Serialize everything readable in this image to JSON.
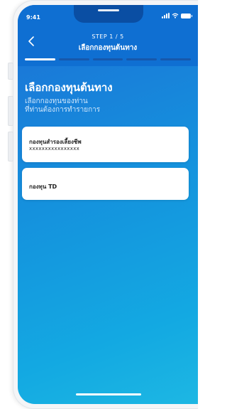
{
  "status_bar": {
    "time": "9:41",
    "icons": [
      "signal-icon",
      "wifi-icon",
      "battery-icon"
    ]
  },
  "header": {
    "step": "STEP 1 / 5",
    "title": "เลือกกองทุนต้นทาง",
    "back_icon": "chevron-left-icon",
    "progress": {
      "total_steps": 5,
      "current_step": 1
    }
  },
  "main": {
    "title": "เลือกกองทุนต้นทาง",
    "subtitle_line1": "เลือกกองทุนของท่าน",
    "subtitle_line2": "ที่ท่านต้องการทำรายการ",
    "funds": [
      {
        "name": "กองทุนสำรองเลี้ยงชีพ",
        "account": "xxxxxxxxxxxxxxxx"
      },
      {
        "name": "กองทุน TD"
      }
    ]
  },
  "colors": {
    "header_blue": "#0f6fd2",
    "gradient_start": "#1c6fd6",
    "gradient_end": "#1db7e3",
    "card_bg": "#ffffff"
  }
}
